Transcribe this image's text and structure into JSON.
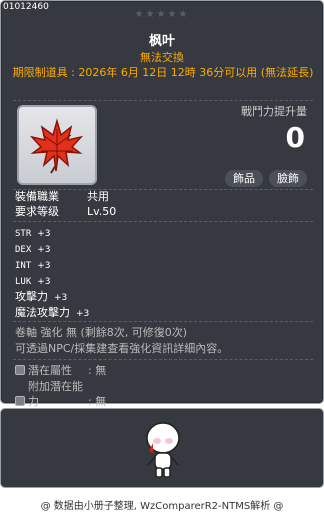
{
  "item": {
    "id": "01012460",
    "stars": "★★★★★",
    "name": "枫叶",
    "untradeable": "無法交換",
    "time_limit": "期限制道具 : 2026年 6月 12日 12時 36分可以用 (無法延長)",
    "icon": "maple-leaf-icon"
  },
  "power": {
    "label": "戰鬥力提升量",
    "value": "0"
  },
  "tags": {
    "jewelry": "飾品",
    "face": "臉飾"
  },
  "requirements": {
    "job_label": "裝備職業",
    "job_value": "共用",
    "level_label": "要求等级",
    "level_value": "Lv.50"
  },
  "stats": [
    {
      "name": "STR",
      "value": "+3"
    },
    {
      "name": "DEX",
      "value": "+3"
    },
    {
      "name": "INT",
      "value": "+3"
    },
    {
      "name": "LUK",
      "value": "+3"
    },
    {
      "name": "攻擊力",
      "value": "+3"
    },
    {
      "name": "魔法攻擊力",
      "value": "+3"
    }
  ],
  "enhancement": {
    "scroll": "卷軸 強化 無 (剩餘8次, 可修復0次)",
    "info": "可透過NPC/採集建查看強化資訊詳細內容。"
  },
  "potential": {
    "main_label": "潛在屬性",
    "main_value": ": 無",
    "additional_label": "附加潛在能力",
    "additional_value": ": 無"
  },
  "preview": {
    "avatar": "character-avatar-icon"
  },
  "footer": {
    "credit": "@ 数据由小册子整理, WzComparerR2-NTMS解析 @"
  },
  "colors": {
    "background": "#36393f",
    "highlight": "#ffaa00",
    "border": "#9aa0a8"
  }
}
